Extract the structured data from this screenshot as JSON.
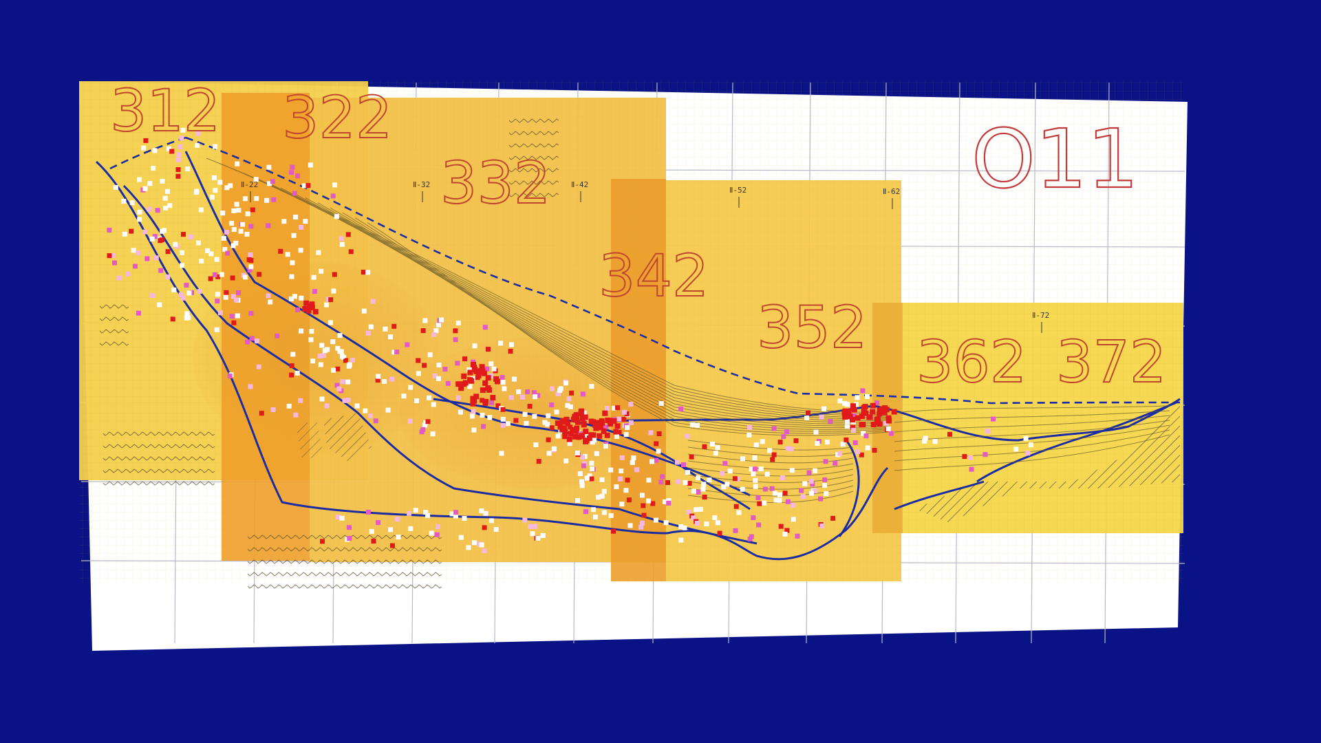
{
  "colors": {
    "background": "#0a1386",
    "grid_paper": "#ffffff",
    "grid_line": "#b8b8c8",
    "sheet_yellow": "#f5d24a",
    "sheet_orange": "#f0b43a",
    "overlap_orange": "#e89a2a",
    "contour_blue": "#1a2ba0",
    "label_red": "#c0452e",
    "marker_red": "#e01a1a",
    "marker_pink": "#e25ac4",
    "marker_light": "#f7b8e0",
    "marker_white": "#ffffff"
  },
  "area_label": "O11",
  "sheets": [
    {
      "id": "sheet-312",
      "label": "312"
    },
    {
      "id": "sheet-322",
      "label": "322"
    },
    {
      "id": "sheet-332",
      "label": "332"
    },
    {
      "id": "sheet-342",
      "label": "342"
    },
    {
      "id": "sheet-352",
      "label": "352"
    },
    {
      "id": "sheet-362",
      "label": "362"
    },
    {
      "id": "sheet-372",
      "label": "372"
    }
  ],
  "section_marks": [
    "Ⅱ-22",
    "Ⅱ-32",
    "Ⅱ-42",
    "Ⅱ-52",
    "Ⅱ-62",
    "Ⅱ-72"
  ]
}
